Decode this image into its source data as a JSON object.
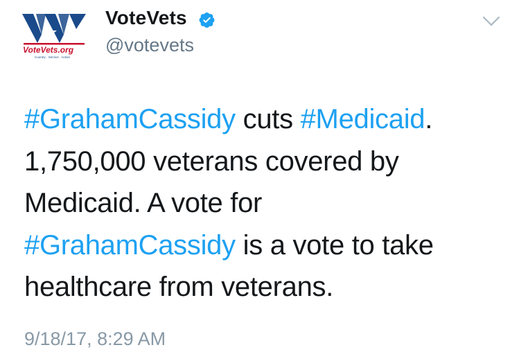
{
  "tweet": {
    "author": {
      "display_name": "VoteVets",
      "handle": "@votevets",
      "verified": true,
      "avatar": {
        "logo_text": "VV",
        "site_text": "VoteVets.org",
        "tagline": "Country · Service · Action",
        "colors": {
          "primary": "#1a4a8a",
          "accent": "#c8102e"
        }
      }
    },
    "menu_icon": "chevron-down-icon",
    "text_lines": [
      [
        {
          "text": "#GrahamCassidy",
          "type": "hashtag"
        },
        {
          "text": " cuts ",
          "type": "text"
        },
        {
          "text": "#Medicaid",
          "type": "hashtag"
        },
        {
          "text": ".",
          "type": "text"
        }
      ],
      [
        {
          "text": "1,750,000 veterans covered by",
          "type": "text"
        }
      ],
      [
        {
          "text": "Medicaid. A vote for",
          "type": "text"
        }
      ],
      [
        {
          "text": "#GrahamCassidy",
          "type": "hashtag"
        },
        {
          "text": " is a vote to take",
          "type": "text"
        }
      ],
      [
        {
          "text": "healthcare from veterans.",
          "type": "text"
        }
      ]
    ],
    "timestamp": "9/18/17, 8:29 AM"
  },
  "colors": {
    "link": "#1da1f2",
    "text": "#14171a",
    "secondary": "#657786",
    "verified": "#1da1f2"
  }
}
